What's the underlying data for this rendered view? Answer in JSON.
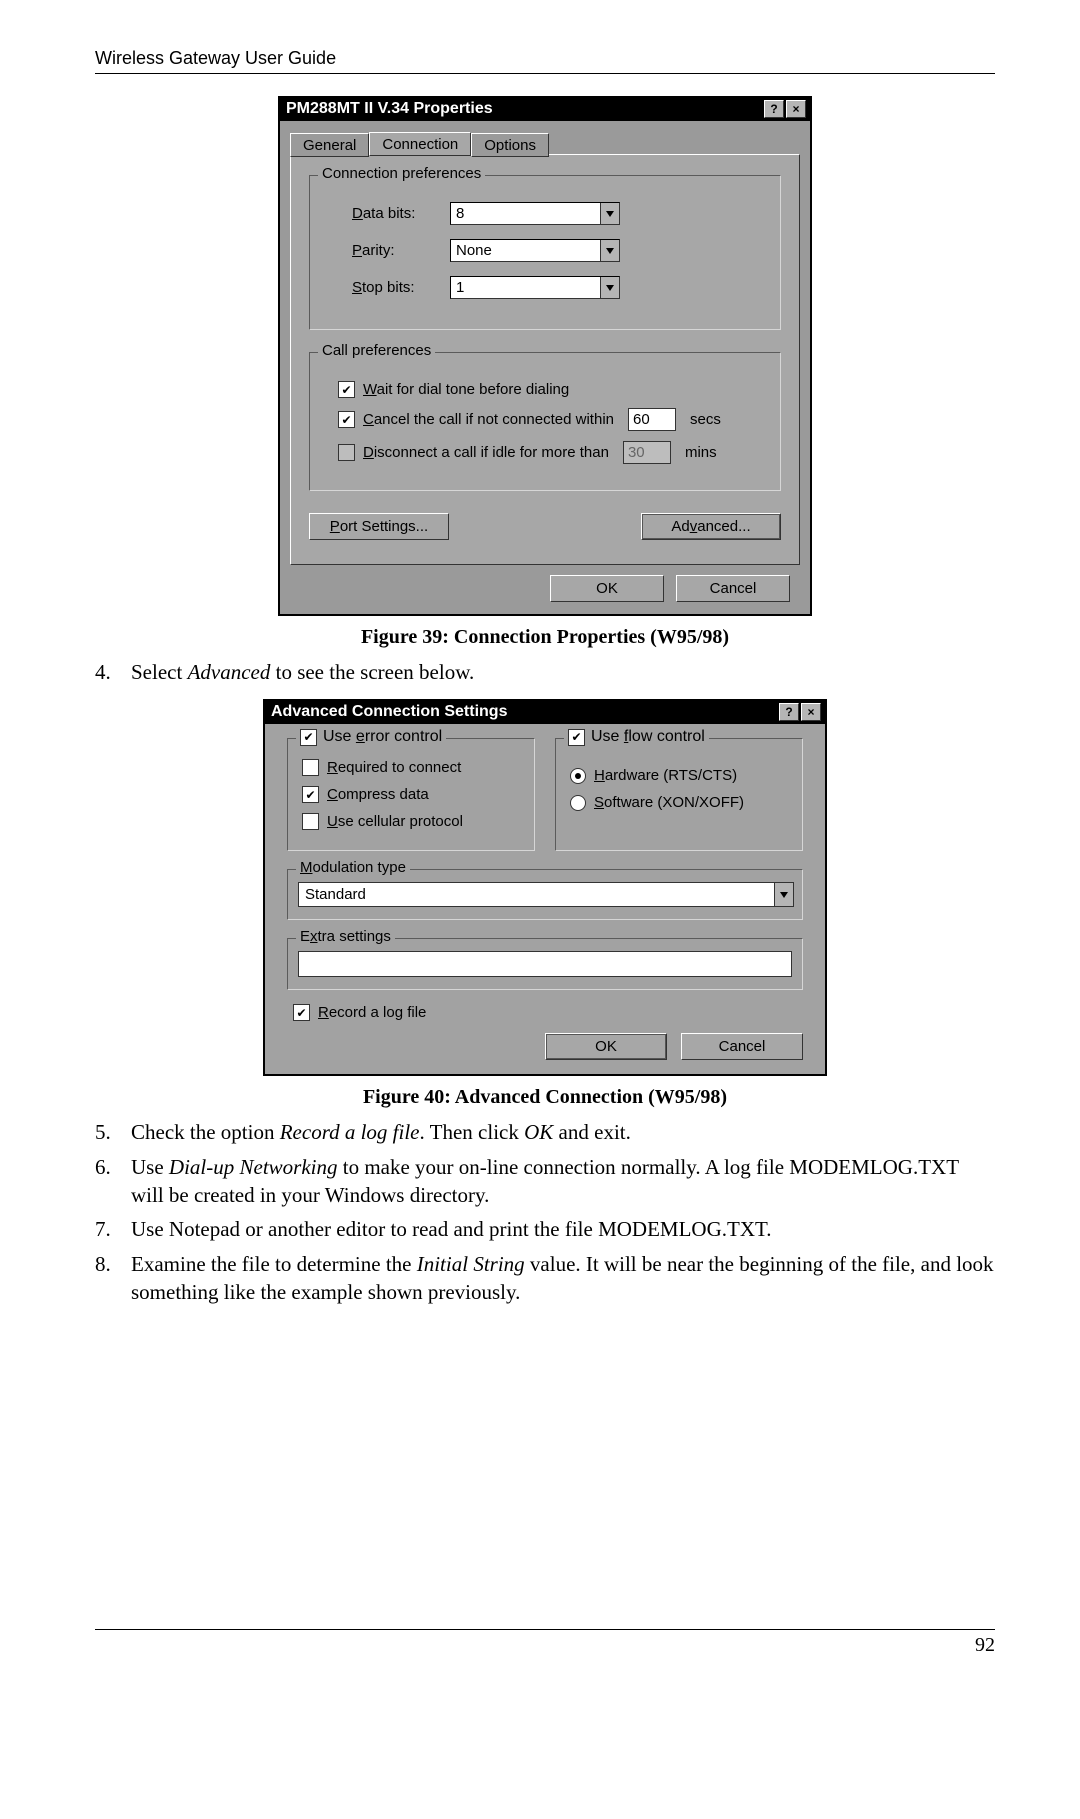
{
  "header": "Wireless Gateway User Guide",
  "fig39_caption": "Figure 39: Connection Properties (W95/98)",
  "fig40_caption": "Figure 40: Advanced Connection (W95/98)",
  "step4_n": "4.",
  "step4_pre": "Select ",
  "step4_em": "Advanced",
  "step4_post": " to see the screen below.",
  "step5_n": "5.",
  "step5_pre": "Check the option ",
  "step5_em": "Record a log file",
  "step5_mid": ". Then click ",
  "step5_em2": "OK",
  "step5_post": " and exit.",
  "step6_n": "6.",
  "step6_pre": "Use ",
  "step6_em": "Dial-up Networking",
  "step6_post": " to make your on-line connection normally. A log file MODEMLOG.TXT will be created in your Windows directory.",
  "step7_n": "7.",
  "step7_t": "Use Notepad or another editor to read and print the file MODEMLOG.TXT.",
  "step8_n": "8.",
  "step8_pre": "Examine the file to determine the ",
  "step8_em": "Initial String",
  "step8_post": " value. It will be near the beginning of the file, and look something like the example shown previously.",
  "page_num": "92",
  "dlg1": {
    "title": "PM288MT II V.34 Properties",
    "help": "?",
    "close": "×",
    "tabs": {
      "general": "General",
      "connection": "Connection",
      "options": "Options"
    },
    "conn_pref": "Connection preferences",
    "data_bits_label_pre": "D",
    "data_bits_label_post": "ata bits:",
    "parity_label_pre": "P",
    "parity_label_post": "arity:",
    "stop_bits_label_pre": "S",
    "stop_bits_label_post": "top bits:",
    "data_bits_value": "8",
    "parity_value": "None",
    "stop_bits_value": "1",
    "call_pref": "Call preferences",
    "wait_pre": "W",
    "wait_post": "ait for dial tone before dialing",
    "cancel_pre": "C",
    "cancel_post": "ancel the call if not connected within",
    "cancel_secs": "60",
    "cancel_unit": "secs",
    "disc_pre": "D",
    "disc_post": "isconnect a call if idle for more than",
    "disc_mins": "30",
    "disc_unit": "mins",
    "port_pre": "P",
    "port_post": "ort Settings...",
    "adv_pre": "Ad",
    "adv_u": "v",
    "adv_post": "anced...",
    "ok": "OK",
    "cancel_btn": "Cancel"
  },
  "dlg2": {
    "title": "Advanced Connection Settings",
    "help": "?",
    "close": "×",
    "use_err_pre": "Use ",
    "use_err_u": "e",
    "use_err_post": "rror control",
    "req_pre": "R",
    "req_post": "equired to connect",
    "comp_pre": "C",
    "comp_post": "ompress data",
    "cell_pre": "U",
    "cell_post": "se cellular protocol",
    "use_flow_pre": "Use ",
    "use_flow_u": "f",
    "use_flow_post": "low control",
    "hw_pre": "H",
    "hw_post": "ardware (RTS/CTS)",
    "sw_pre": "S",
    "sw_post": "oftware (XON/XOFF)",
    "mod_pre": "M",
    "mod_post": "odulation type",
    "mod_value": "Standard",
    "extra_pre": "E",
    "extra_u": "x",
    "extra_post": "tra settings",
    "record_pre": "R",
    "record_post": "ecord a log file",
    "ok": "OK",
    "cancel": "Cancel"
  }
}
